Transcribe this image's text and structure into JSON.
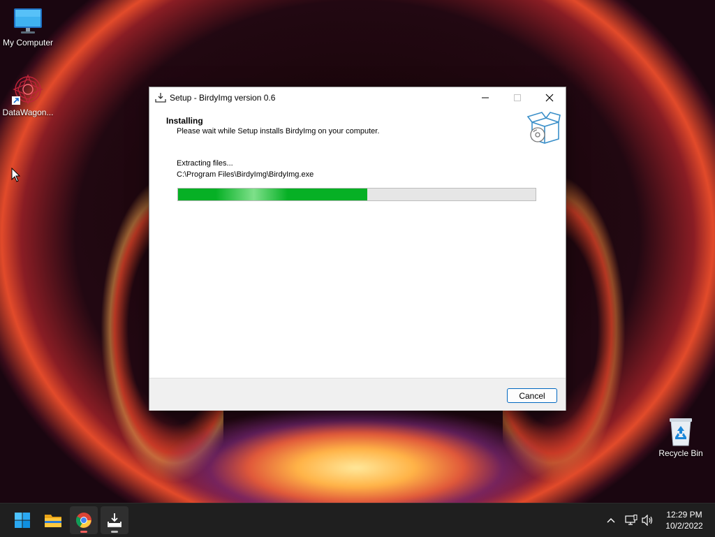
{
  "desktop": {
    "icons": [
      {
        "label": "My Computer",
        "icon": "monitor-icon"
      },
      {
        "label": "DataWagon...",
        "icon": "datawagon-app-icon"
      },
      {
        "label": "Recycle Bin",
        "icon": "recycle-bin-icon"
      }
    ]
  },
  "dialog": {
    "title": "Setup - BirdyImg version 0.6",
    "header_title": "Installing",
    "header_subtitle": "Please wait while Setup installs BirdyImg on your computer.",
    "status_text": "Extracting files...",
    "current_file": "C:\\Program Files\\BirdyImg\\BirdyImg.exe",
    "progress_percent": 53,
    "cancel_label": "Cancel",
    "colors": {
      "progress": "#06b025",
      "button_border": "#0067c0"
    }
  },
  "taskbar": {
    "apps": [
      {
        "icon": "windows-start-icon"
      },
      {
        "icon": "file-explorer-icon"
      },
      {
        "icon": "chrome-icon"
      },
      {
        "icon": "setup-installer-icon"
      }
    ],
    "tray": {
      "icons": [
        "chevron-up-icon",
        "network-icon",
        "volume-icon"
      ]
    },
    "clock": {
      "time": "12:29 PM",
      "date": "10/2/2022"
    }
  }
}
